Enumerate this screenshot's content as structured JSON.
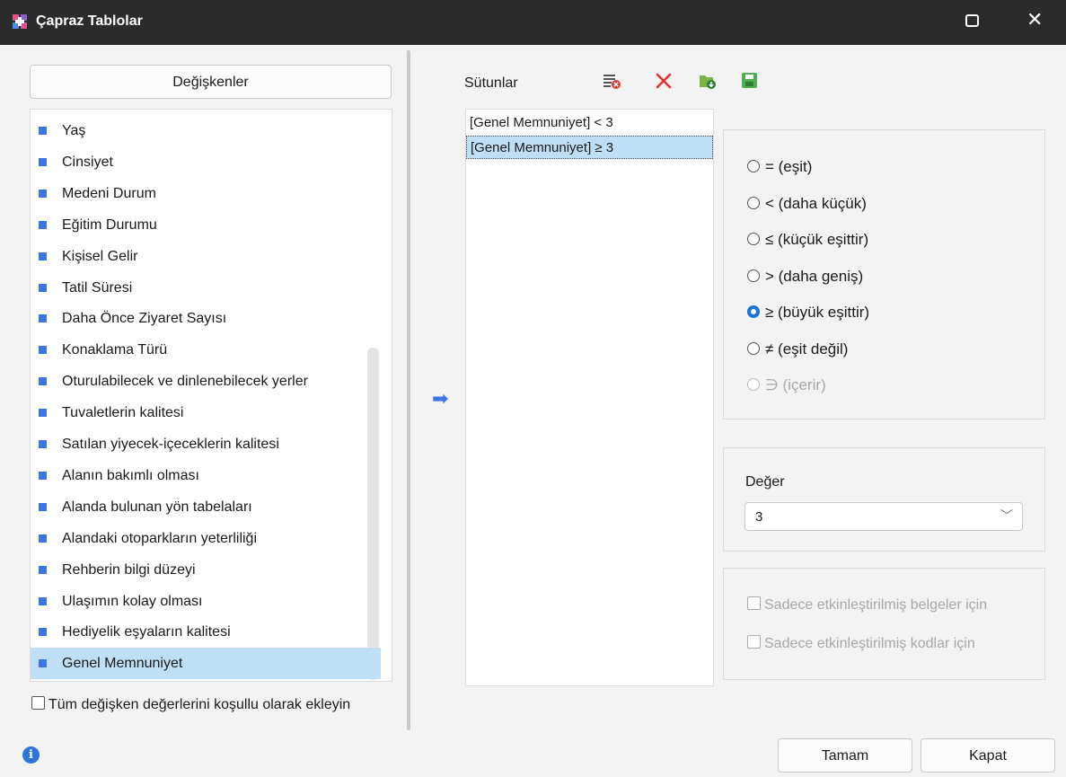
{
  "window": {
    "title": "Çapraz Tablolar",
    "icons": {
      "app": "plus-grid-icon",
      "maximize": "maximize-icon",
      "close": "close-icon"
    },
    "close_glyph": "✕"
  },
  "variables": {
    "header": "Değişkenler",
    "items": [
      "Yaş",
      "Cinsiyet",
      "Medeni Durum",
      "Eğitim Durumu",
      "Kişisel Gelir",
      "Tatil Süresi",
      "Daha Önce Ziyaret Sayısı",
      "Konaklama Türü",
      "Oturulabilecek ve dinlenebilecek yerler",
      "Tuvaletlerin kalitesi",
      "Satılan yiyecek-içeceklerin kalitesi",
      "Alanın bakımlı olması",
      "Alanda bulunan yön tabelaları",
      "Alandaki otoparkların yeterliliği",
      "Rehberin bilgi düzeyi",
      "Ulaşımın kolay olması",
      "Hediyelik eşyaların kalitesi",
      "Genel Memnuniyet"
    ],
    "selected_index": 17,
    "add_conditionally_label": "Tüm değişken değerlerini koşullu olarak ekleyin"
  },
  "transfer": {
    "icon": "arrow-right-icon",
    "glyph": "➡"
  },
  "columns": {
    "label": "Sütunlar",
    "toolbar_icons": [
      "clear-list-icon",
      "delete-icon",
      "open-folder-icon",
      "save-icon"
    ],
    "items": [
      "[Genel Memnuniyet] < 3",
      "[Genel Memnuniyet] ≥ 3"
    ],
    "selected_index": 1
  },
  "operators": {
    "options": [
      "= (eşit)",
      "< (daha küçük)",
      "≤ (küçük eşittir)",
      "> (daha geniş)",
      "≥ (büyük eşittir)",
      "≠ (eşit değil)",
      "∋ (içerir)"
    ],
    "selected_index": 4,
    "disabled_index": 6
  },
  "value": {
    "label": "Değer",
    "selected": "3"
  },
  "options": {
    "only_active_documents": "Sadece etkinleştirilmiş belgeler için",
    "only_active_codes": "Sadece etkinleştirilmiş kodlar için"
  },
  "footer": {
    "ok": "Tamam",
    "close": "Kapat",
    "info_glyph": "i"
  },
  "colors": {
    "accent": "#3b76e8",
    "selection": "#bfdff7",
    "titlebar": "#2b2b2b",
    "radio_checked": "#1a73d9"
  }
}
